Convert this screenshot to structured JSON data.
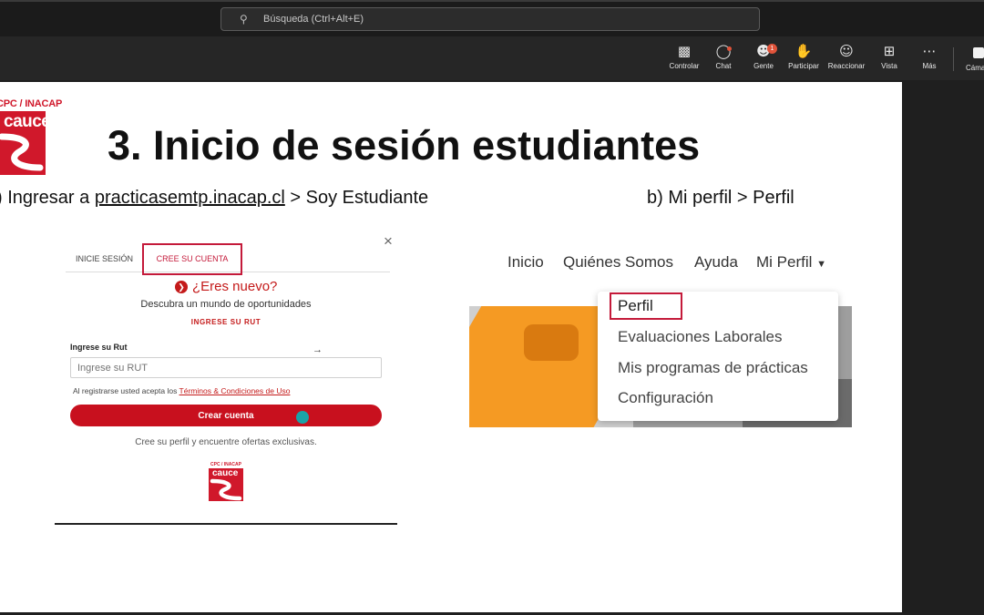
{
  "app": {
    "search": {
      "placeholder": "Búsqueda (Ctrl+Alt+E)",
      "icon": "search-icon"
    },
    "toolbar": [
      {
        "label": "Controlar",
        "icon": "screen-share-icon"
      },
      {
        "label": "Chat",
        "icon": "chat-icon"
      },
      {
        "label": "Gente",
        "icon": "people-icon",
        "badge": "1"
      },
      {
        "label": "Participar",
        "icon": "raise-hand-icon"
      },
      {
        "label": "Reaccionar",
        "icon": "smiley-icon"
      },
      {
        "label": "Vista",
        "icon": "grid-view-icon"
      },
      {
        "label": "Más",
        "icon": "more-icon"
      }
    ],
    "camera_label": "Cáma"
  },
  "slide": {
    "logo_top": "CPC / INACAP",
    "logo_word": "cauce",
    "title": "3. Inicio de sesión estudiantes",
    "step_a_prefix": ") Ingresar a ",
    "step_a_link": "practicasemtp.inacap.cl",
    "step_a_suffix": " > Soy Estudiante",
    "step_b": "b) Mi perfil > Perfil"
  },
  "login": {
    "close": "×",
    "tab_login": "INICIE SESIÓN",
    "tab_create": "CREE SU CUENTA",
    "eres_nuevo": "¿Eres nuevo?",
    "description": "Descubra un mundo de oportunidades",
    "rut_heading": "INGRESE SU RUT",
    "field_label": "Ingrese su Rut",
    "field_placeholder": "Ingrese su RUT",
    "terms_prefix": "Al registrarse usted acepta los ",
    "terms_link": "Términos & Condiciones de Uso",
    "button": "Crear cuenta",
    "footer": "Cree su perfil y encuentre ofertas exclusivas.",
    "mini_logo_top": "CPC / INACAP",
    "mini_logo_word": "cauce"
  },
  "site_nav": {
    "items": [
      "Inicio",
      "Quiénes Somos",
      "Ayuda",
      "Mi Perfil"
    ],
    "dropdown": [
      "Perfil",
      "Evaluaciones Laborales",
      "Mis programas de prácticas",
      "Configuración"
    ]
  }
}
